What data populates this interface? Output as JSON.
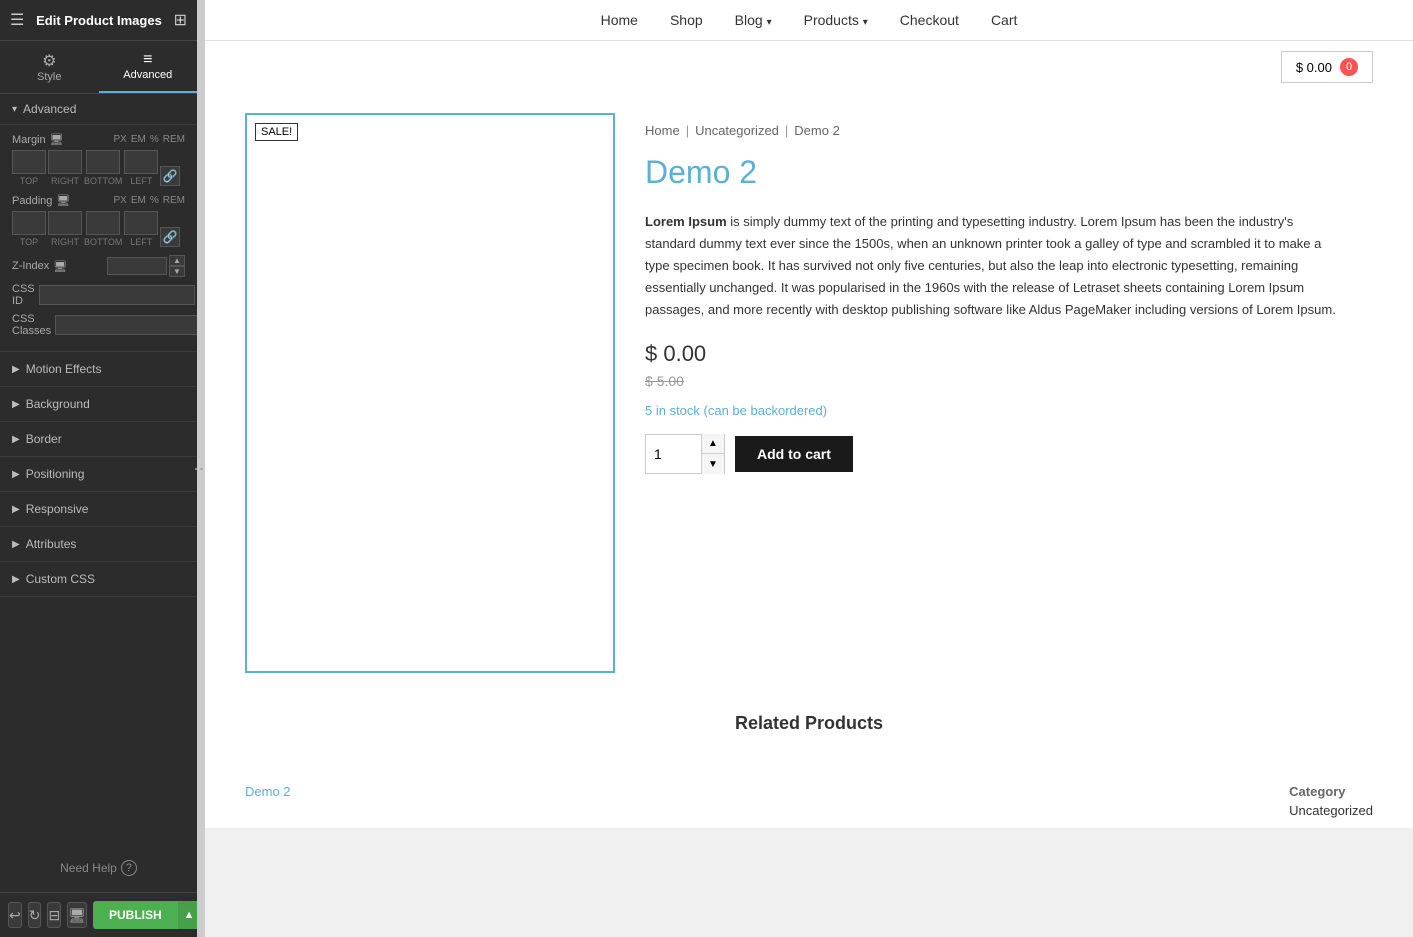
{
  "panel": {
    "title": "Edit Product Images",
    "tabs": [
      {
        "id": "style",
        "label": "Style",
        "icon": "⚙"
      },
      {
        "id": "advanced",
        "label": "Advanced",
        "icon": "≡"
      }
    ],
    "active_tab": "advanced",
    "advanced_section": {
      "label": "Advanced",
      "margin": {
        "label": "Margin",
        "top": "",
        "right": "",
        "bottom": "",
        "left": "",
        "units": [
          "PX",
          "EM",
          "%",
          "REM"
        ]
      },
      "padding": {
        "label": "Padding",
        "top": "",
        "right": "",
        "bottom": "",
        "left": "",
        "units": [
          "PX",
          "EM",
          "%",
          "REM"
        ]
      },
      "zindex": {
        "label": "Z-Index"
      },
      "css_id": {
        "label": "CSS ID"
      },
      "css_classes": {
        "label": "CSS Classes"
      }
    },
    "sections": [
      {
        "id": "motion-effects",
        "label": "Motion Effects"
      },
      {
        "id": "background",
        "label": "Background"
      },
      {
        "id": "border",
        "label": "Border"
      },
      {
        "id": "positioning",
        "label": "Positioning"
      },
      {
        "id": "responsive",
        "label": "Responsive"
      },
      {
        "id": "attributes",
        "label": "Attributes"
      },
      {
        "id": "custom-css",
        "label": "Custom CSS"
      }
    ],
    "need_help": "Need Help",
    "footer": {
      "publish": "PUBLISH"
    }
  },
  "nav": {
    "links": [
      {
        "id": "home",
        "label": "Home",
        "has_arrow": false
      },
      {
        "id": "shop",
        "label": "Shop",
        "has_arrow": false
      },
      {
        "id": "blog",
        "label": "Blog",
        "has_arrow": true
      },
      {
        "id": "products",
        "label": "Products",
        "has_arrow": true
      },
      {
        "id": "checkout",
        "label": "Checkout",
        "has_arrow": false
      },
      {
        "id": "cart",
        "label": "Cart",
        "has_arrow": false
      }
    ]
  },
  "cart": {
    "label": "$ 0.00",
    "badge": "0"
  },
  "breadcrumb": {
    "home": "Home",
    "sep1": "|",
    "category": "Uncategorized",
    "sep2": "|",
    "current": "Demo 2"
  },
  "product": {
    "sale_badge": "SALE!",
    "title": "Demo 2",
    "description_bold": "Lorem Ipsum",
    "description_text": " is simply dummy text of the printing and typesetting industry. Lorem Ipsum has been the industry's standard dummy text ever since the 1500s, when an unknown printer took a galley of type and scrambled it to make a type specimen book. It has survived not only five centuries, but also the leap into electronic typesetting, remaining essentially unchanged. It was popularised in the 1960s with the release of Letraset sheets containing Lorem Ipsum passages, and more recently with desktop publishing software like Aldus PageMaker including versions of Lorem Ipsum.",
    "price": "$ 0.00",
    "old_price": "$ 5.00",
    "stock": "5 in stock (can be backordered)",
    "qty": "1",
    "add_to_cart": "Add to cart",
    "name_footer": "Demo 2",
    "category_label": "Category",
    "category_value": "Uncategorized"
  },
  "related": {
    "title": "Related Products"
  }
}
